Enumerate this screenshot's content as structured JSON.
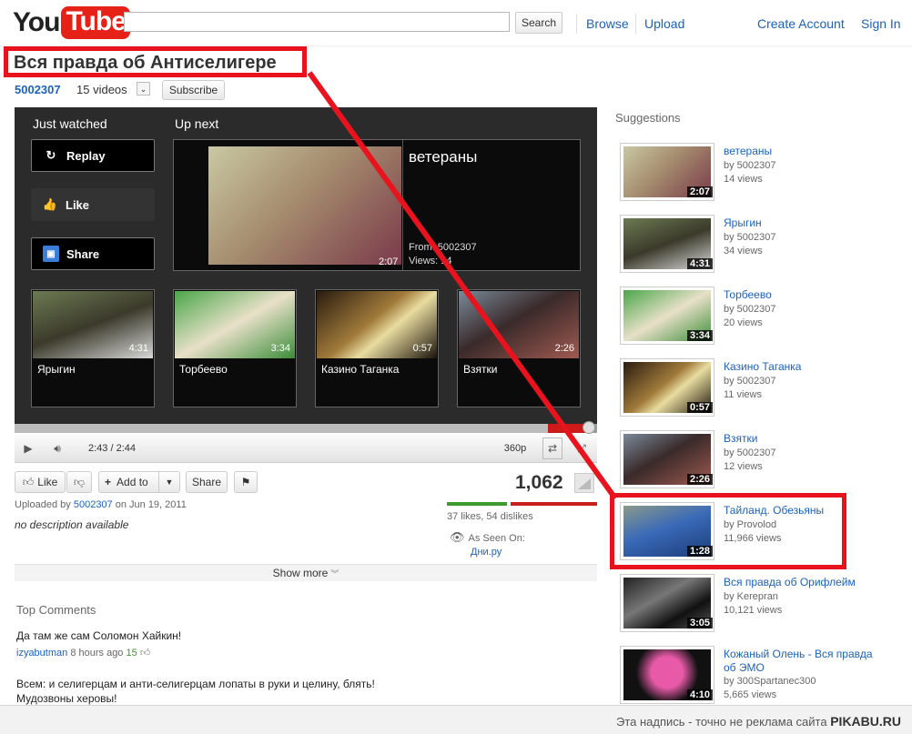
{
  "header": {
    "logo_you": "You",
    "logo_tube": "Tube",
    "search_value": "",
    "search_button": "Search",
    "nav": [
      "Browse",
      "Upload"
    ],
    "create_account": "Create Account",
    "sign_in": "Sign In"
  },
  "video": {
    "title": "Вся правда об Антиселигере",
    "channel": "5002307",
    "video_count": "15 videos",
    "subscribe": "Subscribe"
  },
  "player": {
    "just_watched": "Just watched",
    "up_next": "Up next",
    "replay": "Replay",
    "like": "Like",
    "share": "Share",
    "upnext_video": {
      "title": "ветераны",
      "duration": "2:07",
      "from": "From: 5002307",
      "views": "Views: 14"
    },
    "related": [
      {
        "title": "Ярыгин",
        "duration": "4:31"
      },
      {
        "title": "Торбеево",
        "duration": "3:34"
      },
      {
        "title": "Казино Таганка",
        "duration": "0:57"
      },
      {
        "title": "Взятки",
        "duration": "2:26"
      }
    ],
    "progress": 0.935,
    "time": "2:43 / 2:44",
    "quality": "360p"
  },
  "actions": {
    "like": "Like",
    "add_to": "Add to",
    "share": "Share",
    "view_count": "1,062",
    "likes_text": "37 likes, 54 dislikes",
    "like_ratio": 0.407,
    "as_seen_on": "As Seen On:",
    "seen_on_site": "Дни.ру",
    "show_more": "Show more"
  },
  "meta": {
    "uploaded_prefix": "Uploaded by",
    "uploader": "5002307",
    "uploaded_suffix": "on Jun 19, 2011",
    "description": "no description available"
  },
  "comments": {
    "heading": "Top Comments",
    "items": [
      {
        "text": "Да там же сам Соломон Хайкин!",
        "author": "izyabutman",
        "time": "8 hours ago",
        "score": "15"
      },
      {
        "text": "Всем: и селигерцам и анти-селигерцам лопаты в руки и целину, блять! Мудозвоны херовы!"
      }
    ]
  },
  "suggestions": {
    "heading": "Suggestions",
    "items": [
      {
        "title": "ветераны",
        "by": "by 5002307",
        "views": "14 views",
        "duration": "2:07"
      },
      {
        "title": "Ярыгин",
        "by": "by 5002307",
        "views": "34 views",
        "duration": "4:31"
      },
      {
        "title": "Торбеево",
        "by": "by 5002307",
        "views": "20 views",
        "duration": "3:34"
      },
      {
        "title": "Казино Таганка",
        "by": "by 5002307",
        "views": "11 views",
        "duration": "0:57"
      },
      {
        "title": "Взятки",
        "by": "by 5002307",
        "views": "12 views",
        "duration": "2:26"
      },
      {
        "title": "Тайланд. Обезьяны",
        "by": "by Provolod",
        "views": "11,966 views",
        "duration": "1:28"
      },
      {
        "title": "Вся правда об Орифлейм",
        "by": "by Kerepran",
        "views": "10,121 views",
        "duration": "3:05"
      },
      {
        "title": "Кожаный Олень - Вся правда",
        "title2": "об ЭМО",
        "by": "by 300Spartanec300",
        "views": "5,665 views",
        "duration": "4:10"
      }
    ]
  },
  "footer": {
    "text": "Эта надпись - точно не реклама сайта",
    "brand": "PIKABU.RU"
  },
  "colors": {
    "accent_red": "#e8131c",
    "link_blue": "#1c62b9",
    "youtube_red": "#e62117"
  }
}
